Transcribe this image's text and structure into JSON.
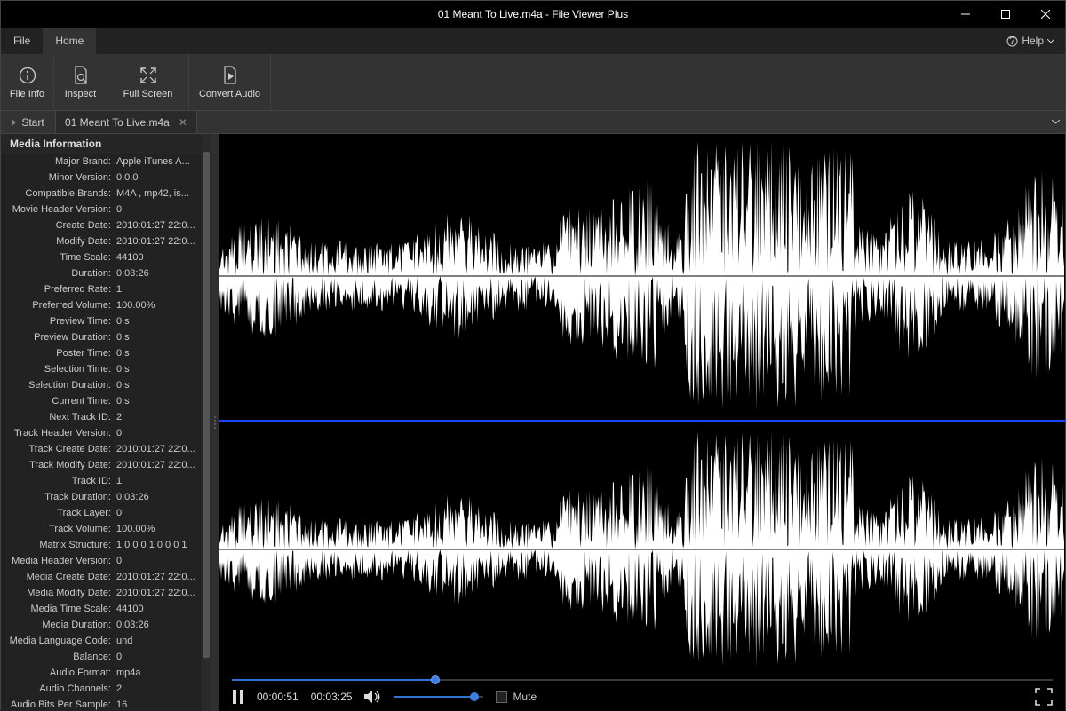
{
  "window": {
    "title": "01 Meant To Live.m4a - File Viewer Plus"
  },
  "menubar": {
    "file": "File",
    "home": "Home",
    "help": "Help"
  },
  "ribbon": {
    "file_info": "File Info",
    "inspect": "Inspect",
    "full_screen": "Full Screen",
    "convert_audio": "Convert Audio"
  },
  "tabs": {
    "start": "Start",
    "doc": "01 Meant To Live.m4a"
  },
  "side_header": "Media Information",
  "media_info": [
    {
      "label": "Major Brand:",
      "value": "Apple iTunes A..."
    },
    {
      "label": "Minor Version:",
      "value": "0.0.0"
    },
    {
      "label": "Compatible Brands:",
      "value": "M4A , mp42, is..."
    },
    {
      "label": "Movie Header Version:",
      "value": "0"
    },
    {
      "label": "Create Date:",
      "value": "2010:01:27 22:0..."
    },
    {
      "label": "Modify Date:",
      "value": "2010:01:27 22:0..."
    },
    {
      "label": "Time Scale:",
      "value": "44100"
    },
    {
      "label": "Duration:",
      "value": "0:03:26"
    },
    {
      "label": "Preferred Rate:",
      "value": "1"
    },
    {
      "label": "Preferred Volume:",
      "value": "100.00%"
    },
    {
      "label": "Preview Time:",
      "value": "0 s"
    },
    {
      "label": "Preview Duration:",
      "value": "0 s"
    },
    {
      "label": "Poster Time:",
      "value": "0 s"
    },
    {
      "label": "Selection Time:",
      "value": "0 s"
    },
    {
      "label": "Selection Duration:",
      "value": "0 s"
    },
    {
      "label": "Current Time:",
      "value": "0 s"
    },
    {
      "label": "Next Track ID:",
      "value": "2"
    },
    {
      "label": "Track Header Version:",
      "value": "0"
    },
    {
      "label": "Track Create Date:",
      "value": "2010:01:27 22:0..."
    },
    {
      "label": "Track Modify Date:",
      "value": "2010:01:27 22:0..."
    },
    {
      "label": "Track ID:",
      "value": "1"
    },
    {
      "label": "Track Duration:",
      "value": "0:03:26"
    },
    {
      "label": "Track Layer:",
      "value": "0"
    },
    {
      "label": "Track Volume:",
      "value": "100.00%"
    },
    {
      "label": "Matrix Structure:",
      "value": "1 0 0 0 1 0 0 0 1"
    },
    {
      "label": "Media Header Version:",
      "value": "0"
    },
    {
      "label": "Media Create Date:",
      "value": "2010:01:27 22:0..."
    },
    {
      "label": "Media Modify Date:",
      "value": "2010:01:27 22:0..."
    },
    {
      "label": "Media Time Scale:",
      "value": "44100"
    },
    {
      "label": "Media Duration:",
      "value": "0:03:26"
    },
    {
      "label": "Media Language Code:",
      "value": "und"
    },
    {
      "label": "Balance:",
      "value": "0"
    },
    {
      "label": "Audio Format:",
      "value": "mp4a"
    },
    {
      "label": "Audio Channels:",
      "value": "2"
    },
    {
      "label": "Audio Bits Per Sample:",
      "value": "16"
    }
  ],
  "player": {
    "current_time": "00:00:51",
    "total_time": "00:03:25",
    "mute_label": "Mute",
    "progress_pct": 25,
    "volume_pct": 90
  }
}
